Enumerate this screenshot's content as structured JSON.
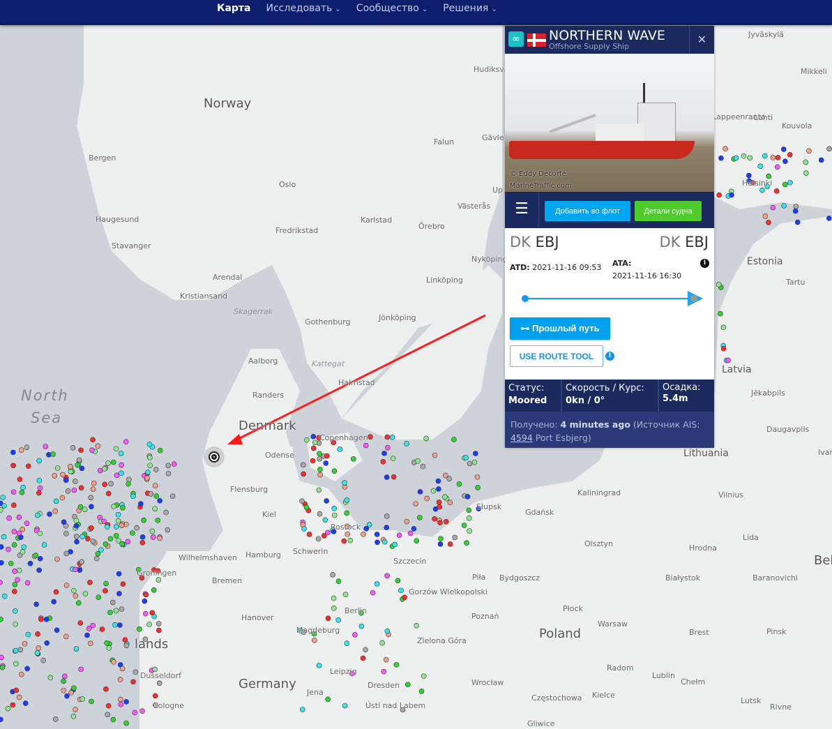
{
  "nav": {
    "items": [
      {
        "label": "Карта",
        "active": true
      },
      {
        "label": "Исследовать"
      },
      {
        "label": "Сообщество"
      },
      {
        "label": "Решения"
      }
    ]
  },
  "map": {
    "labels": {
      "norway": "Norway",
      "bergen": "Bergen",
      "haugesund": "Haugesund",
      "stavanger": "Stavanger",
      "oslo": "Oslo",
      "fredrikstad": "Fredrikstad",
      "arendal": "Arendal",
      "kristiansand": "Kristiansand",
      "skagerrak": "Skagerrak",
      "gothenburg": "Gothenburg",
      "aalborg": "Aalborg",
      "randers": "Randers",
      "kattegat": "Kattegat",
      "denmark": "Denmark",
      "odense": "Odense",
      "copenhagen": "Copenhagen",
      "halmstad": "Halmstad",
      "north": "North",
      "sea": "Sea",
      "flensburg": "Flensburg",
      "kiel": "Kiel",
      "hamburg": "Hamburg",
      "bremen": "Bremen",
      "groningen": "Groningen",
      "wilhelmshaven": "Wilhelmshaven",
      "schwerin": "Schwerin",
      "rostock": "Rostock",
      "szczecin": "Szczecin",
      "berlin": "Berlin",
      "magdeburg": "Magdeburg",
      "leipzig": "Leipzig",
      "dresden": "Dresden",
      "germany": "Germany",
      "hanover": "Hanover",
      "dusseldorf": "Dusseldorf",
      "cologne": "Cologne",
      "jena": "Jena",
      "netherlands": "lands",
      "usti": "Ústí nad Labem",
      "poland": "Poland",
      "poznan": "Poznań",
      "gdansk": "Gdańsk",
      "slupsk": "Słupsk",
      "kaliningrad": "Kaliningrad",
      "olsztyn": "Olsztyn",
      "bydgoszcz": "Bydgoszcz",
      "pila": "Piła",
      "gorzow": "Gorzów Wielkopolski",
      "zielona": "Zielona Góra",
      "wroclaw": "Wrocław",
      "plock": "Płock",
      "warsaw": "Warsaw",
      "radom": "Radom",
      "lublin": "Lublin",
      "kielce": "Kielce",
      "czestochowa": "Częstochowa",
      "gliwice": "Gliwice",
      "chelm": "Chełm",
      "brest": "Brest",
      "pinsk": "Pinsk",
      "lutsk": "Lutsk",
      "rivne": "Rivne",
      "hrodna": "Hrodna",
      "lida": "Lida",
      "baranovichi": "Baranovichi",
      "bialystok": "Białystok",
      "vilnius": "Vilnius",
      "lithuania": "Lithuania",
      "latvia": "Latvia",
      "jekabpils": "Jēkabpils",
      "daugavpils": "Daugavpils",
      "estonia": "Estonia",
      "tartu": "Tartu",
      "helsinki": "Helsinki",
      "lahti": "Lahti",
      "kouvola": "Kouvola",
      "lappeenranta": "Lappeenranta",
      "jyvaskyla": "Jyväskylä",
      "mikkeli": "Mikkeli",
      "bel": "Bel",
      "ivan": "Ivan",
      "linkoping": "Linköping",
      "norrkoping": "Nyköping",
      "jonkoping": "Jönköping",
      "karlstad": "Karlstad",
      "orebro": "Örebro",
      "vasteras": "Västerås",
      "falun": "Falun",
      "gavle": "Gävle",
      "hudiksvall": "Hudiksvall",
      "upp": "Up"
    }
  },
  "vessel": {
    "name": "NORTHERN WAVE",
    "type": "Offshore Supply Ship",
    "photo_credit": "© Eddy Decorte",
    "photo_site": "MarineTraffic.com",
    "add_fleet": "Добавить во флот",
    "details": "Детали судна",
    "departure": {
      "cc": "DK",
      "port": "EBJ"
    },
    "arrival": {
      "cc": "DK",
      "port": "EBJ"
    },
    "atd_label": "ATD:",
    "atd": "2021-11-16 09:53",
    "ata_label": "ATA:",
    "ata": "2021-11-16 16:30",
    "past_track": "Прошлый путь",
    "route_tool": "USE ROUTE TOOL",
    "status_label": "Статус:",
    "status": "Moored",
    "speed_label": "Скорость / Курс:",
    "speed": "0kn / 0°",
    "draught_label": "Осадка:",
    "draught": "5.4m",
    "received_label": "Получено:",
    "received": "4 minutes ago",
    "source_pre": "(Источник AIS:",
    "source_id": "4594",
    "source_post": "Port Esbjerg)"
  },
  "colors": {
    "nav": "#0b1d6b",
    "panel": "#1b2a5e",
    "blue": "#00a7ee",
    "green": "#4fcb2e",
    "arrow": "#ff1a1a"
  }
}
